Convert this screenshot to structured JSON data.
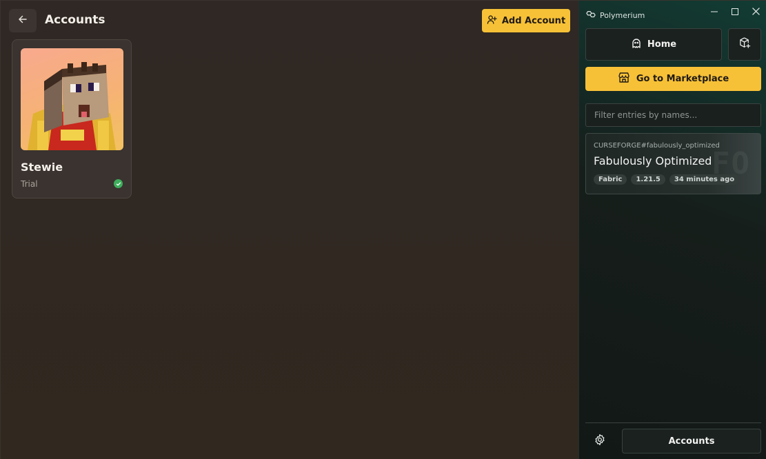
{
  "header": {
    "title": "Accounts",
    "add_account_label": "Add Account"
  },
  "accounts": [
    {
      "name": "Stewie",
      "type": "Trial",
      "status": "active"
    }
  ],
  "sidebar": {
    "app_name": "Polymerium",
    "home_label": "Home",
    "marketplace_label": "Go to Marketplace",
    "filter_placeholder": "Filter entries by names...",
    "entries": [
      {
        "reference": "CURSEFORGE#fabulously_optimized",
        "title": "Fabulously Optimized",
        "watermark": "FO",
        "tags": [
          "Fabric",
          "1.21.5",
          "34 minutes ago"
        ]
      }
    ],
    "accounts_label": "Accounts"
  },
  "colors": {
    "accent": "#f7c137",
    "success": "#3eae5c",
    "main_bg": "#30271f",
    "sidebar_bg": "#161e1b"
  },
  "icons": {
    "back": "arrow-left-icon",
    "add_user": "user-plus-icon",
    "check": "check-circle-icon",
    "logo": "polymerium-logo-icon",
    "home": "ghost-icon",
    "package": "package-plus-icon",
    "store": "store-icon",
    "settings": "gear-icon"
  }
}
